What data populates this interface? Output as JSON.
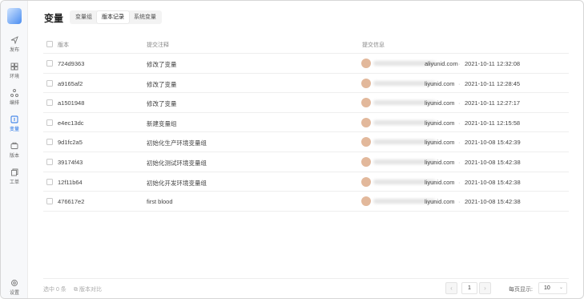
{
  "sidebar": {
    "items": [
      {
        "label": "发布",
        "icon": "send-icon"
      },
      {
        "label": "环境",
        "icon": "environment-icon"
      },
      {
        "label": "编排",
        "icon": "orchestration-icon"
      },
      {
        "label": "变量",
        "icon": "variable-icon",
        "active": true
      },
      {
        "label": "版本",
        "icon": "version-icon"
      },
      {
        "label": "工单",
        "icon": "ticket-icon"
      }
    ],
    "settings_label": "设置"
  },
  "page": {
    "title": "变量",
    "tabs": [
      "变量组",
      "版本记录",
      "系统变量"
    ],
    "active_tab": "版本记录"
  },
  "table": {
    "headers": {
      "version": "版本",
      "note": "提交注释",
      "info": "提交信息"
    },
    "rows": [
      {
        "version": "724d9363",
        "note": "修改了变量",
        "email": "aliyunid.com",
        "time": "2021-10-11 12:32:08"
      },
      {
        "version": "a9165af2",
        "note": "修改了变量",
        "email": "liyunid.com",
        "time": "2021-10-11 12:28:45"
      },
      {
        "version": "a1501948",
        "note": "修改了变量",
        "email": "liyunid.com",
        "time": "2021-10-11 12:27:17"
      },
      {
        "version": "e4ec13dc",
        "note": "新建变量组",
        "email": "liyunid.com",
        "time": "2021-10-11 12:15:58"
      },
      {
        "version": "9d1fc2a5",
        "note": "初始化生产环境变量组",
        "email": "liyunid.com",
        "time": "2021-10-08 15:42:39"
      },
      {
        "version": "39174f43",
        "note": "初始化测试环境变量组",
        "email": "liyunid.com",
        "time": "2021-10-08 15:42:38"
      },
      {
        "version": "12f11b64",
        "note": "初始化开发环境变量组",
        "email": "liyunid.com",
        "time": "2021-10-08 15:42:38"
      },
      {
        "version": "476617e2",
        "note": "first blood",
        "email": "liyunid.com",
        "time": "2021-10-08 15:42:38"
      }
    ],
    "separator": "·"
  },
  "footer": {
    "selected": "选中 0 条",
    "compare": "版本对比",
    "current_page": "1",
    "page_size_label": "每页显示:",
    "page_size": "10"
  },
  "colors": {
    "accent": "#1f6fe5",
    "avatar": "#e2b89b"
  }
}
